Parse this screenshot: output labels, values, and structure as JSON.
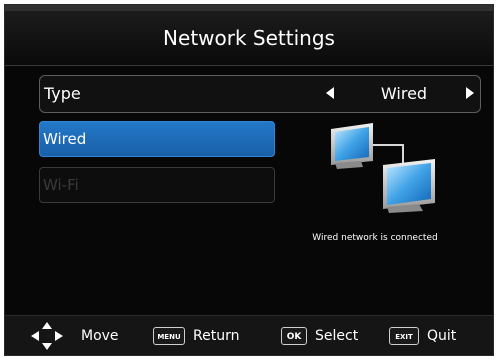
{
  "title": "Network Settings",
  "type_row": {
    "label": "Type",
    "value": "Wired"
  },
  "options": [
    {
      "label": "Wired",
      "selected": true
    },
    {
      "label": "Wi-Fi",
      "selected": false
    }
  ],
  "status_text": "Wired network is connected",
  "footer": {
    "move_label": "Move",
    "menu_key": "MENU",
    "return_label": "Return",
    "ok_key": "OK",
    "select_label": "Select",
    "exit_key": "EXIT",
    "quit_label": "Quit"
  },
  "colors": {
    "selected_bg": "#2378c8",
    "screen_bg": "#070707"
  },
  "icons": [
    "network-connection-icon",
    "dpad-icon",
    "arrow-left-icon",
    "arrow-right-icon"
  ]
}
